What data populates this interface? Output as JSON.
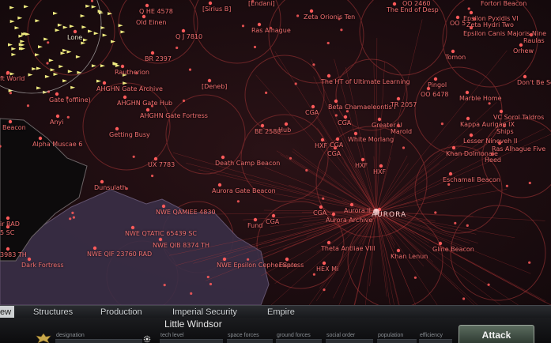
{
  "map": {
    "labels": [
      {
        "text": "Q HE 4578",
        "kind": "red"
      },
      {
        "text": "[Sirius B]",
        "kind": "red"
      },
      {
        "text": "[Endani]",
        "kind": "red"
      },
      {
        "text": "Zeta Orionis Ten",
        "kind": "red"
      },
      {
        "text": "OO 2460",
        "kind": "red"
      },
      {
        "text": "The End of Desp",
        "kind": "red"
      },
      {
        "text": "Fortori Beacon",
        "kind": "red"
      },
      {
        "text": "Epsilon Pyxidis VI",
        "kind": "red"
      },
      {
        "text": "OO 5",
        "kind": "red"
      },
      {
        "text": "Zeta Hydri Two",
        "kind": "red"
      },
      {
        "text": "Epsilon Canis Majoris Nine",
        "kind": "red"
      },
      {
        "text": "Raulas",
        "kind": "red"
      },
      {
        "text": "Orhew",
        "kind": "red"
      },
      {
        "text": "Old Einen",
        "kind": "red"
      },
      {
        "text": "Q J 7810",
        "kind": "red"
      },
      {
        "text": "Ras Alhague",
        "kind": "red"
      },
      {
        "text": "BR 2397",
        "kind": "red"
      },
      {
        "text": "Tomon",
        "kind": "red"
      },
      {
        "text": "Lone",
        "kind": "white"
      },
      {
        "text": "Rautherion",
        "kind": "red"
      },
      {
        "text": "[Deneb]",
        "kind": "red"
      },
      {
        "text": "The HT of Ultimate Learning",
        "kind": "red"
      },
      {
        "text": "Pingol",
        "kind": "red"
      },
      {
        "text": "Don't Be Sch",
        "kind": "red"
      },
      {
        "text": "ft World",
        "kind": "red"
      },
      {
        "text": "AHGHN Gate Archive",
        "kind": "red"
      },
      {
        "text": "OO 6478",
        "kind": "red"
      },
      {
        "text": "Marble Home",
        "kind": "red"
      },
      {
        "text": "Gate (offline)",
        "kind": "red"
      },
      {
        "text": "AHGHN Gate Hub",
        "kind": "red"
      },
      {
        "text": "TR 2057",
        "kind": "red"
      },
      {
        "text": "Beta Chamaeleontis I",
        "kind": "red"
      },
      {
        "text": "AHGHN Gate Fortress",
        "kind": "red"
      },
      {
        "text": "CGA",
        "kind": "red"
      },
      {
        "text": "VC Sorol Taldros",
        "kind": "red"
      },
      {
        "text": "Anyi",
        "kind": "red"
      },
      {
        "text": "CGA",
        "kind": "red"
      },
      {
        "text": "Greater U",
        "kind": "red"
      },
      {
        "text": "Kappa Aurigae IX",
        "kind": "red"
      },
      {
        "text": "Beacon",
        "kind": "red"
      },
      {
        "text": "BE 2580",
        "kind": "red"
      },
      {
        "text": "Hub",
        "kind": "red"
      },
      {
        "text": "Marold",
        "kind": "red"
      },
      {
        "text": "Ships",
        "kind": "red"
      },
      {
        "text": "Getting Busy",
        "kind": "red"
      },
      {
        "text": "White Morlang",
        "kind": "red"
      },
      {
        "text": "Lesser Nineveh II",
        "kind": "red"
      },
      {
        "text": "Alpha Muscae 6",
        "kind": "red"
      },
      {
        "text": "HXF",
        "kind": "red"
      },
      {
        "text": "CGA",
        "kind": "red"
      },
      {
        "text": "Ras Alhague Five",
        "kind": "red"
      },
      {
        "text": "CGA",
        "kind": "red"
      },
      {
        "text": "Khan Dolmonale",
        "kind": "red"
      },
      {
        "text": "Heed",
        "kind": "red"
      },
      {
        "text": "UX 7783",
        "kind": "red"
      },
      {
        "text": "Death Camp Beacon",
        "kind": "red"
      },
      {
        "text": "HXF",
        "kind": "red"
      },
      {
        "text": "HXF",
        "kind": "red"
      },
      {
        "text": "Eschamali Beacon",
        "kind": "red"
      },
      {
        "text": "Dunsulath",
        "kind": "red"
      },
      {
        "text": "Aurora Gate Beacon",
        "kind": "red"
      },
      {
        "text": "NWE QAMIEE 4830",
        "kind": "red"
      },
      {
        "text": "CGA",
        "kind": "red"
      },
      {
        "text": "Aurora II",
        "kind": "red"
      },
      {
        "text": "AURORA",
        "kind": "big"
      },
      {
        "text": "ir RAD",
        "kind": "red"
      },
      {
        "text": "Aurora Archive",
        "kind": "red"
      },
      {
        "text": "CGA",
        "kind": "red"
      },
      {
        "text": "Fund",
        "kind": "red"
      },
      {
        "text": "5 SC",
        "kind": "red"
      },
      {
        "text": "NWE QTATIC 65439 SC",
        "kind": "red"
      },
      {
        "text": "NWE QIB 8374 TH",
        "kind": "red"
      },
      {
        "text": "Theta Antliae VIII",
        "kind": "red"
      },
      {
        "text": "Gline Beacon",
        "kind": "red"
      },
      {
        "text": "NWE QIF 23760 RAD",
        "kind": "red"
      },
      {
        "text": "3983 TH",
        "kind": "red"
      },
      {
        "text": "Khan Lenun",
        "kind": "red"
      },
      {
        "text": "Dark Fortress",
        "kind": "red"
      },
      {
        "text": "NWE Epsilon Cephei Gate",
        "kind": "red"
      },
      {
        "text": "Express",
        "kind": "red"
      },
      {
        "text": "HEX Mi",
        "kind": "red"
      }
    ]
  },
  "tabs": [
    {
      "label": "ew"
    },
    {
      "label": "Structures"
    },
    {
      "label": "Production"
    },
    {
      "label": "Imperial Security"
    },
    {
      "label": "Empire"
    }
  ],
  "planet": {
    "name": "Little Windsor",
    "fields": [
      {
        "label": "designation"
      },
      {
        "label": "tech level"
      },
      {
        "label": "space forces"
      },
      {
        "label": "ground forces"
      },
      {
        "label": "social order"
      },
      {
        "label": "population"
      },
      {
        "label": "efficiency"
      }
    ]
  },
  "attack_label": "Attack",
  "colors": {
    "planet": "#ff5a5a",
    "link": "#c23a3a",
    "territory": "#6a2426",
    "tab_active": "#cfd2d4"
  }
}
